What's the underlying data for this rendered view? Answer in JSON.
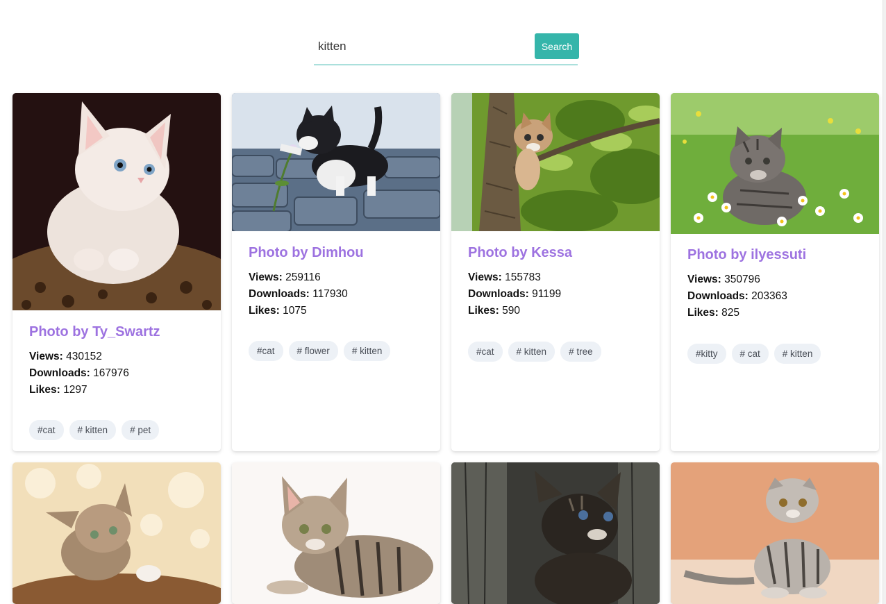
{
  "search": {
    "value": "kitten",
    "button_label": "Search"
  },
  "cards": [
    {
      "title": "Photo by Ty_Swartz",
      "views_label": "Views:",
      "views": "430152",
      "downloads_label": "Downloads:",
      "downloads": "167976",
      "likes_label": "Likes:",
      "likes": "1297",
      "tags": [
        "#cat",
        "# kitten",
        "# pet"
      ]
    },
    {
      "title": "Photo by Dimhou",
      "views_label": "Views:",
      "views": "259116",
      "downloads_label": "Downloads:",
      "downloads": "117930",
      "likes_label": "Likes:",
      "likes": "1075",
      "tags": [
        "#cat",
        "# flower",
        "# kitten"
      ]
    },
    {
      "title": "Photo by Kessa",
      "views_label": "Views:",
      "views": "155783",
      "downloads_label": "Downloads:",
      "downloads": "91199",
      "likes_label": "Likes:",
      "likes": "590",
      "tags": [
        "#cat",
        "# kitten",
        "# tree"
      ]
    },
    {
      "title": "Photo by ilyessuti",
      "views_label": "Views:",
      "views": "350796",
      "downloads_label": "Downloads:",
      "downloads": "203363",
      "likes_label": "Likes:",
      "likes": "825",
      "tags": [
        "#kitty",
        "# cat",
        "# kitten"
      ]
    }
  ],
  "colors": {
    "accent": "#35b5aa",
    "title": "#9d72e0",
    "tag_bg": "#edf1f6"
  }
}
